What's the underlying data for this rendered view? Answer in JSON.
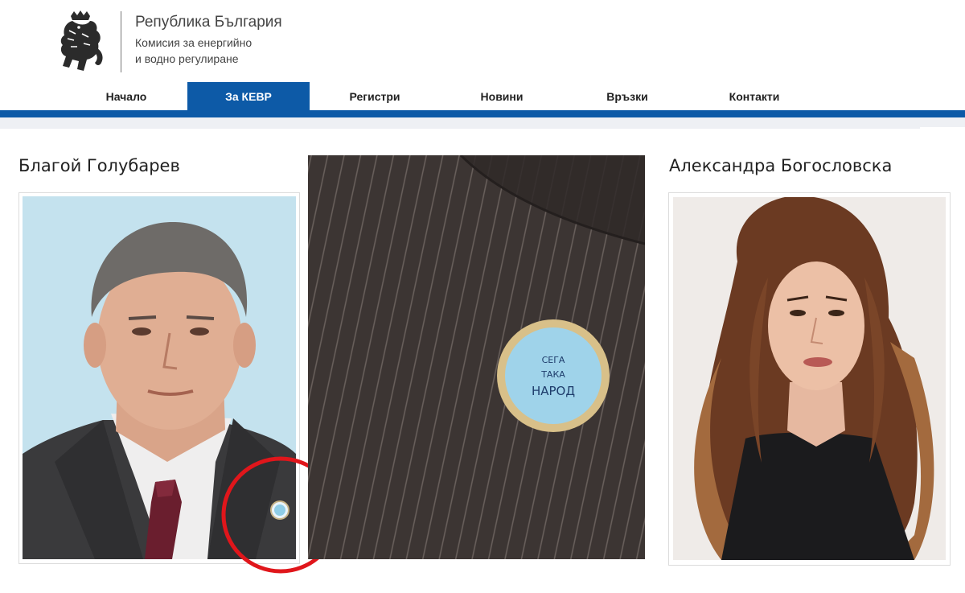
{
  "header": {
    "title": "Република България",
    "subtitle_line1": "Комисия за енергийно",
    "subtitle_line2": "и водно регулиране",
    "logo_icon": "lion-coat-of-arms-icon"
  },
  "nav": {
    "items": [
      {
        "label": "Начало"
      },
      {
        "label": "За КЕВР"
      },
      {
        "label": "Регистри"
      },
      {
        "label": "Новини"
      },
      {
        "label": "Връзки"
      },
      {
        "label": "Контакти"
      }
    ],
    "active_index": 1
  },
  "people": [
    {
      "name": "Благой Голубарев",
      "photo": "portrait-man-suit-badge"
    },
    {
      "name": "Александра Богословска",
      "photo": "portrait-woman-long-hair"
    }
  ],
  "zoom": {
    "photo": "badge-closeup",
    "badge_text_line1": "СЕГА",
    "badge_text_line2": "ТАКА",
    "badge_text_line3": "НАРОД"
  },
  "colors": {
    "accent": "#0d5aa7",
    "highlight_circle": "#e0161b"
  }
}
